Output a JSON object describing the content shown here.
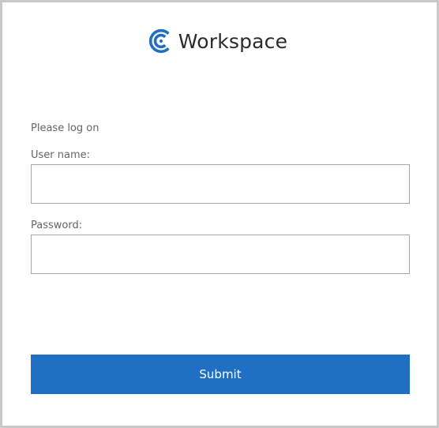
{
  "header": {
    "brand_name": "Workspace",
    "logo_icon": "workspace-logo-icon",
    "brand_color": "#1f6fc5"
  },
  "form": {
    "prompt": "Please log on",
    "username": {
      "label": "User name:",
      "value": "",
      "placeholder": ""
    },
    "password": {
      "label": "Password:",
      "value": "",
      "placeholder": ""
    },
    "submit_label": "Submit"
  }
}
